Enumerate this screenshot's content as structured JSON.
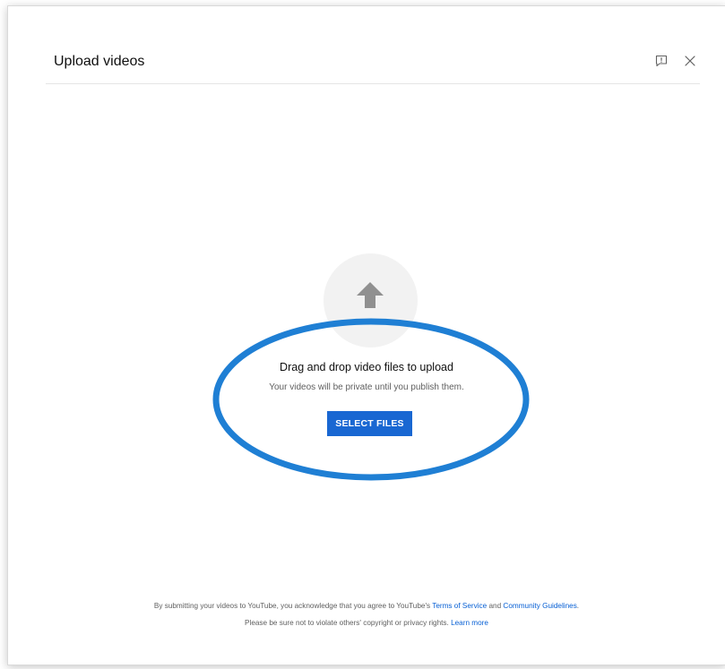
{
  "dialog": {
    "title": "Upload videos",
    "feedback_icon": "feedback-icon",
    "close_icon": "close-icon"
  },
  "upload": {
    "arrow_icon": "upload-arrow-icon",
    "heading": "Drag and drop video files to upload",
    "subtext": "Your videos will be private until you publish them.",
    "button_label": "SELECT FILES"
  },
  "footer": {
    "line1_prefix": "By submitting your videos to YouTube, you acknowledge that you agree to YouTube's ",
    "terms_link": "Terms of Service",
    "and_text": " and ",
    "guidelines_link": "Community Guidelines",
    "line1_suffix": ".",
    "line2_prefix": "Please be sure not to violate others' copyright or privacy rights. ",
    "learn_more_link": "Learn more"
  },
  "colors": {
    "primary_button": "#1967d2",
    "link": "#065fd4",
    "annotation_ring": "#1f7fd4"
  }
}
